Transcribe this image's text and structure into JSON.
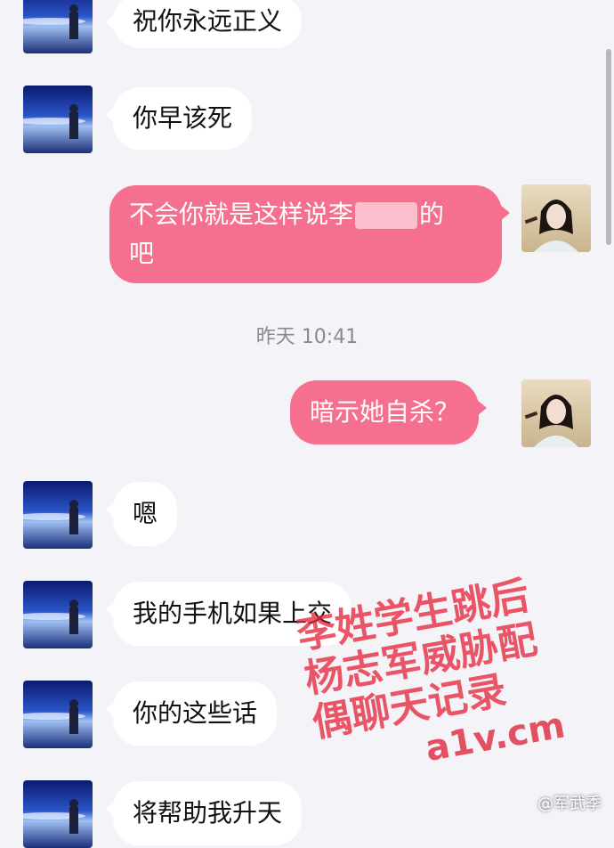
{
  "messages": [
    {
      "side": "in",
      "text": "祝你永远正义"
    },
    {
      "side": "in",
      "text": "你早该死"
    },
    {
      "side": "out",
      "text_before": "不会你就是这样说李",
      "text_after": "的",
      "line2": "吧"
    },
    {
      "side": "out",
      "text": "暗示她自杀？"
    },
    {
      "side": "in",
      "text": "嗯"
    },
    {
      "side": "in",
      "text": "我的手机如果上交"
    },
    {
      "side": "in",
      "text": "你的这些话"
    },
    {
      "side": "in",
      "text": "将帮助我升天"
    }
  ],
  "timestamp": "昨天 10:41",
  "watermark": {
    "lines": [
      "李姓学生跳后",
      "杨志军威胁配",
      "偶聊天记录"
    ],
    "site": "a1v.cm"
  },
  "weibo_tag": "@军武季",
  "colors": {
    "background": "#f4f3f8",
    "out_bubble": "#f56f8e",
    "in_bubble": "#ffffff"
  }
}
